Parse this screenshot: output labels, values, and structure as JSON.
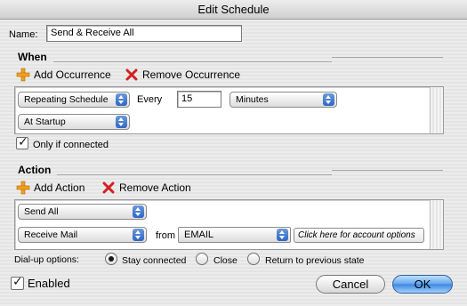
{
  "window": {
    "title": "Edit Schedule"
  },
  "name_field": {
    "label": "Name:",
    "value": "Send & Receive All"
  },
  "when": {
    "title": "When",
    "add_label": "Add Occurrence",
    "remove_label": "Remove Occurrence",
    "schedule_type": "Repeating Schedule",
    "every_label": "Every",
    "interval_value": "15",
    "interval_unit": "Minutes",
    "second_occurrence": "At Startup",
    "only_if_connected_label": "Only if connected",
    "only_if_connected_checked": true
  },
  "action": {
    "title": "Action",
    "add_label": "Add Action",
    "remove_label": "Remove Action",
    "first_action": "Send All",
    "second_action": "Receive Mail",
    "from_label": "from",
    "from_account": "EMAIL",
    "account_options_label": "Click here for account options"
  },
  "dialup": {
    "label": "Dial-up options:",
    "options": [
      "Stay connected",
      "Close",
      "Return to previous state"
    ],
    "selected": "Stay connected"
  },
  "enabled": {
    "label": "Enabled",
    "checked": true
  },
  "buttons": {
    "cancel": "Cancel",
    "ok": "OK"
  },
  "icons": {
    "add": "plus-icon",
    "remove": "red-x-icon",
    "popup_arrows": "updown-arrows-icon"
  },
  "colors": {
    "add_icon": "#f0a020",
    "remove_icon": "#d42020",
    "default_button": "#3d86e0"
  }
}
